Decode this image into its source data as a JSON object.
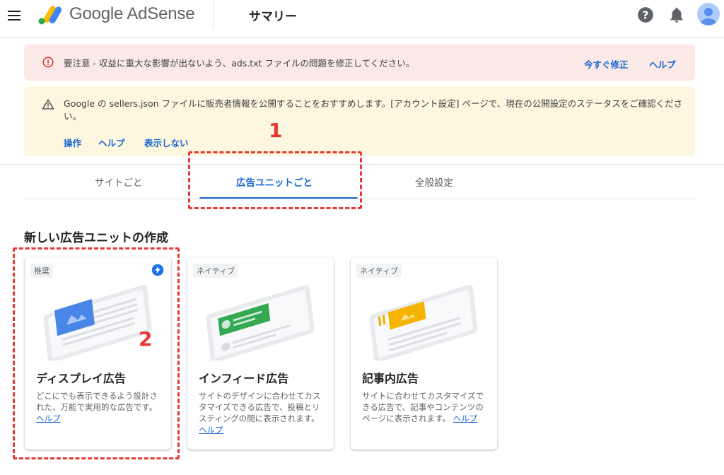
{
  "header": {
    "brand": "Google AdSense",
    "page_title": "サマリー"
  },
  "alerts": {
    "error": {
      "message": "要注意 - 収益に重大な影響が出ないよう、ads.txt ファイルの問題を修正してください。",
      "fix_label": "今すぐ修正",
      "help_label": "ヘルプ"
    },
    "warning": {
      "message": "Google の sellers.json ファイルに販売者情報を公開することをおすすめします。[アカウント設定] ページで、現在の公開設定のステータスをご確認ください。",
      "actions": [
        "操作",
        "ヘルプ",
        "表示しない"
      ]
    }
  },
  "tabs": [
    {
      "label": "サイトごと"
    },
    {
      "label": "広告ユニットごと"
    },
    {
      "label": "全般設定"
    }
  ],
  "section_title": "新しい広告ユニットの作成",
  "cards": [
    {
      "chip": "推奨",
      "title": "ディスプレイ広告",
      "desc": "どこにでも表示できるよう設計された、万能で実用的な広告です。",
      "help": "ヘルプ"
    },
    {
      "chip": "ネイティブ",
      "title": "インフィード広告",
      "desc": "サイトのデザインに合わせてカスタマイズできる広告で、投稿とリスティングの間に表示されます。",
      "help": "ヘルプ"
    },
    {
      "chip": "ネイティブ",
      "title": "記事内広告",
      "desc": "サイトに合わせてカスタマイズできる広告で、記事やコンテンツのページに表示されます。",
      "help": "ヘルプ"
    }
  ],
  "annotations": {
    "one": "1",
    "two": "2"
  },
  "icons": {
    "menu": "menu-icon",
    "logo": "adsense-logo-icon",
    "help": "help-circle-icon",
    "bell": "bell-icon",
    "avatar": "account-avatar-icon",
    "error": "error-circle-icon",
    "warning": "warning-triangle-icon",
    "bolt": "bolt-icon"
  },
  "colors": {
    "accent": "#1967d2",
    "error_bg": "#fbe9e7",
    "warning_bg": "#fef7e0",
    "annotation": "#e53935",
    "display_ad": "#4a86e8",
    "infeed_ad": "#34a853",
    "article_ad": "#f4b400"
  }
}
